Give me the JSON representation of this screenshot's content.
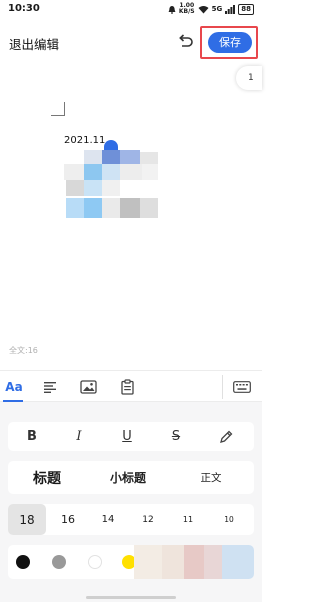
{
  "status_bar": {
    "time": "10:30",
    "net_speed": "1.00",
    "net_unit": "KB/S",
    "network": "5G",
    "battery": "88",
    "icons": [
      "alarm-icon",
      "wifi-icon",
      "signal-icon",
      "battery-icon"
    ]
  },
  "header": {
    "exit_label": "退出编辑",
    "save_label": "保存",
    "highlight_color": "#e8474c",
    "accent_color": "#2f6de5"
  },
  "page_indicator": "1",
  "document": {
    "date_text": "2021.11"
  },
  "word_count": "全文:16",
  "toolbar": {
    "tools": [
      "format-icon",
      "align-icon",
      "image-icon",
      "clipboard-icon",
      "keyboard-icon"
    ],
    "format_glyph": "Aa"
  },
  "format_panel": {
    "styles": {
      "bold": "B",
      "italic": "I",
      "underline": "U",
      "strikethrough": "S"
    },
    "headings": {
      "title": "标题",
      "subtitle": "小标题",
      "body": "正文"
    },
    "font_sizes": [
      "18",
      "16",
      "14",
      "12",
      "11",
      "10"
    ],
    "selected_size": "18",
    "colors": [
      "#111111",
      "#999999",
      "#ffffff",
      "#ffe000"
    ]
  }
}
